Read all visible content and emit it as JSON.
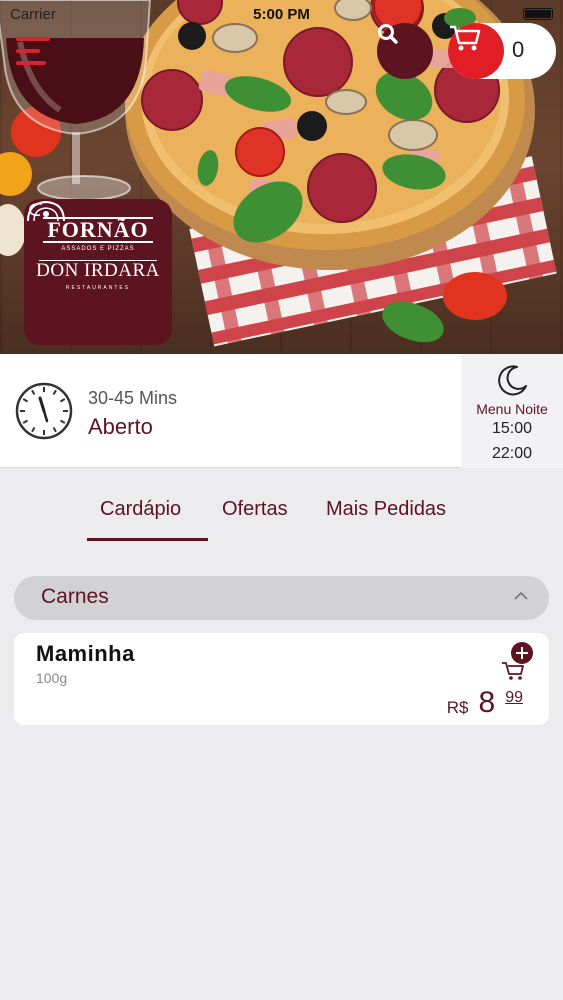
{
  "status_bar": {
    "carrier": "Carrier",
    "time": "5:00 PM"
  },
  "header": {
    "cart_count": "0"
  },
  "logo": {
    "name_top": "FORNÃO",
    "tagline_top": "ASSADOS E PIZZAS",
    "name_bottom": "DON IRDARA",
    "tagline_bottom": "RESTAURANTES"
  },
  "store_info": {
    "delivery_time": "30-45 Mins",
    "status": "Aberto",
    "menu_period": {
      "name": "Menu Noite",
      "start": "15:00",
      "end": "22:00"
    }
  },
  "tabs": [
    {
      "label": "Cardápio",
      "active": true
    },
    {
      "label": "Ofertas",
      "active": false
    },
    {
      "label": "Mais Pedidas",
      "active": false
    }
  ],
  "categories": [
    {
      "title": "Carnes",
      "expanded": true,
      "products": [
        {
          "name": "Maminha",
          "description": "100g",
          "currency": "R$",
          "price_integer": "8",
          "price_cents": "99"
        }
      ]
    }
  ],
  "colors": {
    "brand": "#5c1420",
    "accent_red": "#e11d25",
    "background": "#ececee"
  },
  "icons": {
    "menu": "hamburger-icon",
    "search": "search-icon",
    "cart": "cart-icon",
    "clock": "clock-icon",
    "moon": "moon-icon",
    "collapse": "chevron-up-icon",
    "add_to_cart": "add-to-cart-icon"
  }
}
